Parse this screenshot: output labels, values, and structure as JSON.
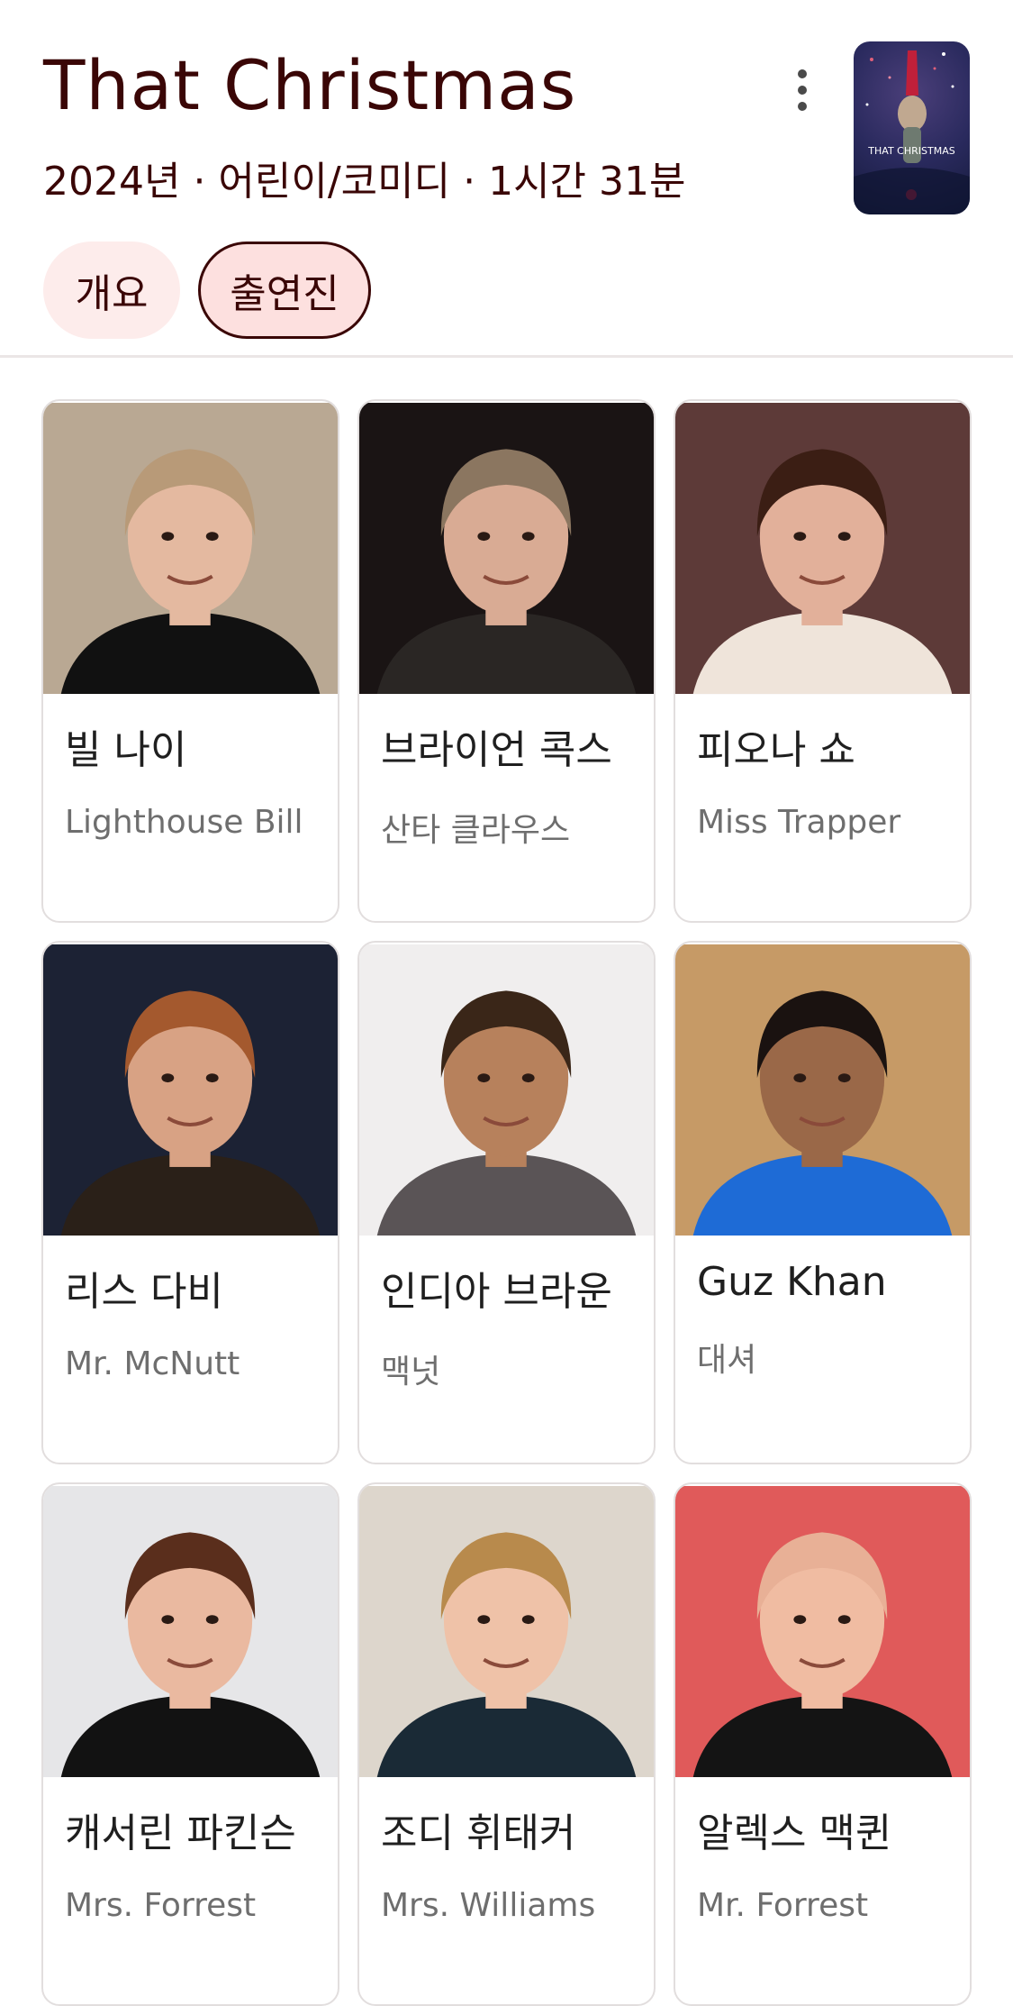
{
  "header": {
    "title": "That Christmas",
    "meta": "2024년 · 어린이/코미디 · 1시간 31분",
    "poster_text": "THAT CHRISTMAS"
  },
  "tabs": [
    {
      "label": "개요",
      "selected": false
    },
    {
      "label": "출연진",
      "selected": true
    }
  ],
  "cast": [
    {
      "name": "빌 나이",
      "role": "Lighthouse Bill",
      "bg": "#b9a893",
      "skin": "#e4b9a0",
      "hair": "#b89a78",
      "suit": "#111111"
    },
    {
      "name": "브라이언 콕스",
      "role": "산타 클라우스",
      "bg": "#1a1414",
      "skin": "#d9ab94",
      "hair": "#8b7660",
      "suit": "#2a2624"
    },
    {
      "name": "피오나 쇼",
      "role": "Miss Trapper",
      "bg": "#5d3a38",
      "skin": "#e2b09a",
      "hair": "#3b1e14",
      "suit": "#efe4da"
    },
    {
      "name": "리스 다비",
      "role": "Mr. McNutt",
      "bg": "#1c2234",
      "skin": "#d8a284",
      "hair": "#a4592e",
      "suit": "#2a2018"
    },
    {
      "name": "인디아 브라운",
      "role": "맥넛",
      "bg": "#f0eeee",
      "skin": "#b7815c",
      "hair": "#3a2618",
      "suit": "#5a5456"
    },
    {
      "name": "Guz Khan",
      "role": "대셔",
      "bg": "#c69a66",
      "skin": "#9a6848",
      "hair": "#1a1210",
      "suit": "#1e6bd6"
    },
    {
      "name": "캐서린 파킨슨",
      "role": "Mrs. Forrest",
      "bg": "#e6e6e8",
      "skin": "#eab9a0",
      "hair": "#5a2e1c",
      "suit": "#121212"
    },
    {
      "name": "조디 휘태커",
      "role": "Mrs. Williams",
      "bg": "#ddd6cc",
      "skin": "#efc2a8",
      "hair": "#b88a4c",
      "suit": "#1a2a36"
    },
    {
      "name": "알렉스 맥퀸",
      "role": "Mr. Forrest",
      "bg": "#e05a5a",
      "skin": "#f0bca2",
      "hair": "#e8b096",
      "suit": "#141414"
    }
  ]
}
